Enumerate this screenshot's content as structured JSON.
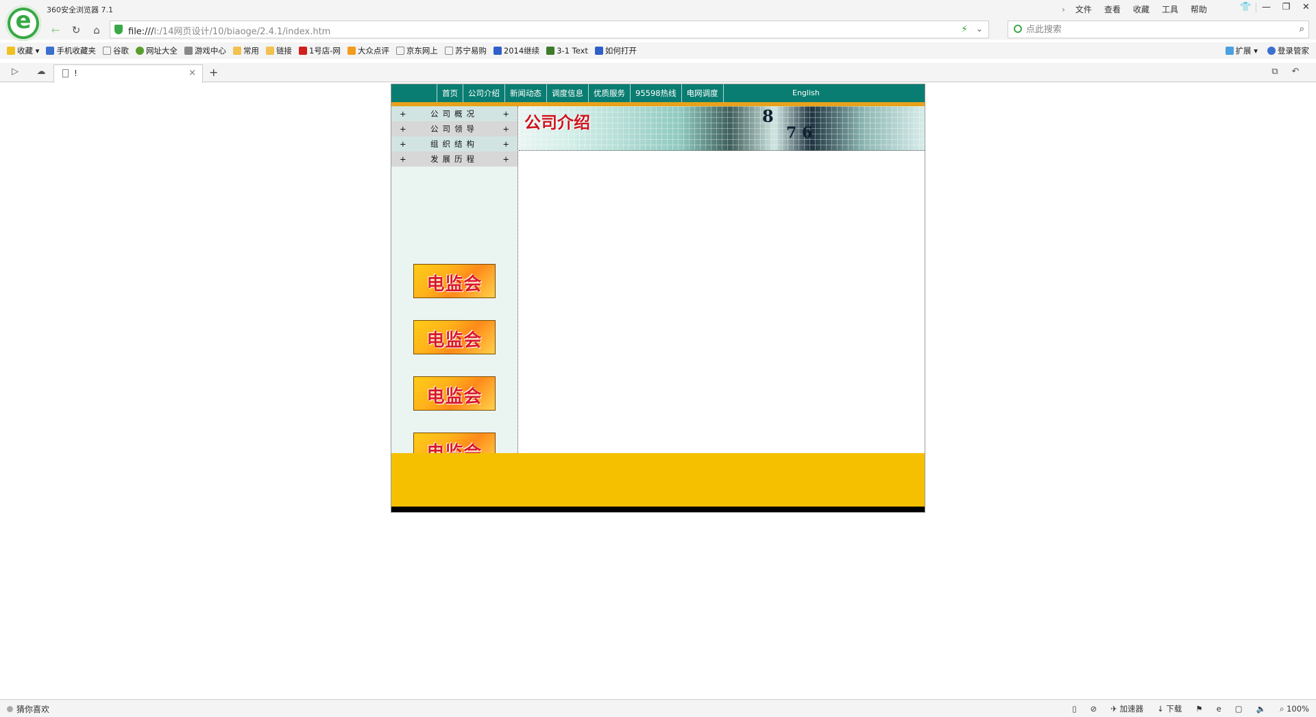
{
  "browser": {
    "title": "360安全浏览器 7.1",
    "menu": [
      "文件",
      "查看",
      "收藏",
      "工具",
      "帮助"
    ],
    "url_protocol": "file:///",
    "url_path": "I:/14网页设计/10/biaoge/2.4.1/index.htm",
    "search_placeholder": "点此搜索",
    "tab_title": "!",
    "bookmarks": [
      "收藏",
      "手机收藏夹",
      "谷歌",
      "网址大全",
      "游戏中心",
      "常用",
      "链接",
      "1号店-网",
      "大众点评",
      "京东网上",
      "苏宁易购",
      "2014继续",
      "3-1 Text",
      "如何打开"
    ],
    "bookmarks_right": [
      "扩展",
      "登录管家"
    ],
    "status_left": "猜你喜欢",
    "status_right": [
      "加速器",
      "下载",
      "100%"
    ]
  },
  "site": {
    "nav": [
      "首页",
      "公司介绍",
      "新闻动态",
      "调度信息",
      "优质服务",
      "95598热线",
      "电网调度"
    ],
    "nav_english": "English",
    "sidebar": [
      "公司概况",
      "公司领导",
      "组织结构",
      "发展历程"
    ],
    "sidebar_marker": "+",
    "ads": [
      "电监会",
      "电监会",
      "电监会",
      "电监会"
    ],
    "banner_title": "公司介绍",
    "banner_numbers_1": "8",
    "banner_numbers_2": "7 6"
  }
}
